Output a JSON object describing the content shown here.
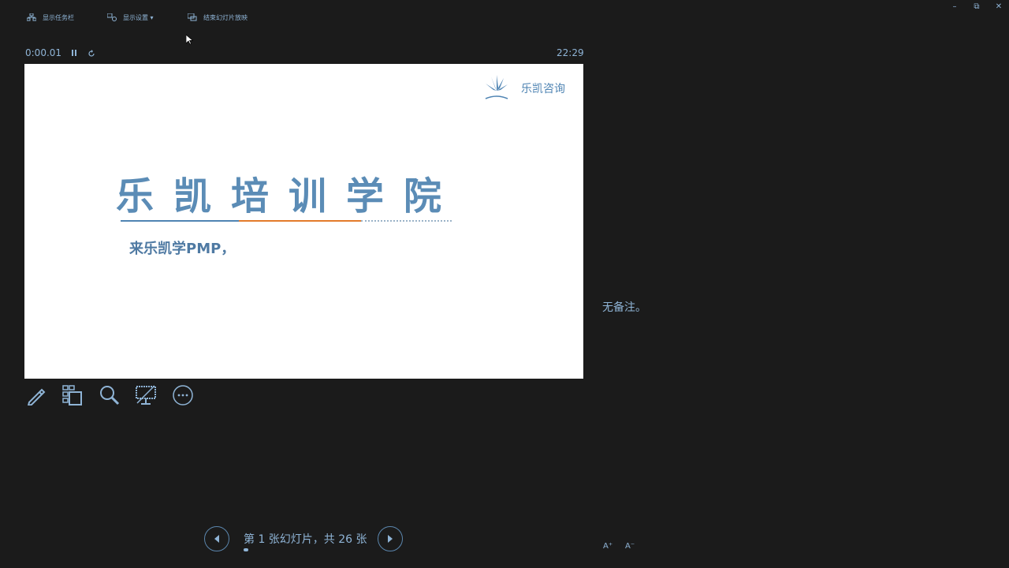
{
  "toolbar": {
    "items": [
      {
        "label": "显示任务栏",
        "icon": "taskbar-icon"
      },
      {
        "label": "显示设置 ▾",
        "icon": "display-settings-icon"
      },
      {
        "label": "结束幻灯片放映",
        "icon": "end-show-icon"
      }
    ]
  },
  "window": {
    "minimize": "–",
    "restore": "⧉",
    "close": "✕"
  },
  "timer": {
    "elapsed": "0:00.01",
    "clock": "22:29"
  },
  "slide": {
    "title": "乐凯培训学院",
    "subtitle": "来乐凯学PMP，",
    "brand_name": "乐凯咨询",
    "colors": {
      "title": "#5b8cb6",
      "accent_orange": "#e37b2a",
      "accent_blue": "#4f84b3"
    }
  },
  "tools": [
    "pen-icon",
    "see-all-slides-icon",
    "zoom-icon",
    "black-screen-icon",
    "more-options-icon"
  ],
  "notes": {
    "text": "无备注。"
  },
  "navigation": {
    "slide_counter": "第 1 张幻灯片，共 26 张"
  },
  "font_controls": {
    "increase": "A⁺",
    "decrease": "A⁻"
  }
}
